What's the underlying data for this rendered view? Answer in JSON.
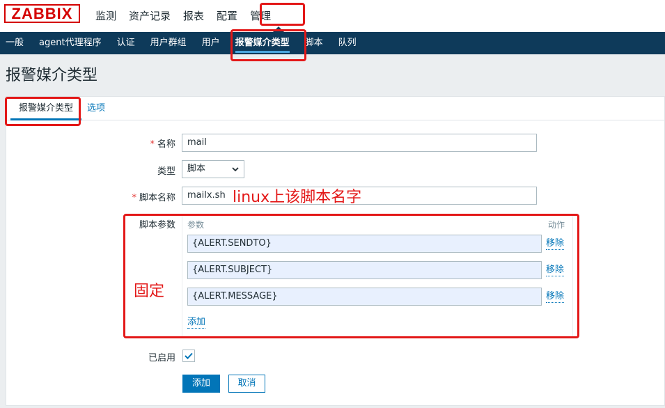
{
  "brand": {
    "logo": "ZABBIX"
  },
  "top_menu": [
    {
      "label": "监测"
    },
    {
      "label": "资产记录"
    },
    {
      "label": "报表"
    },
    {
      "label": "配置"
    },
    {
      "label": "管理"
    }
  ],
  "sub_menu": [
    {
      "label": "一般"
    },
    {
      "label": "agent代理程序"
    },
    {
      "label": "认证"
    },
    {
      "label": "用户群组"
    },
    {
      "label": "用户"
    },
    {
      "label": "报警媒介类型"
    },
    {
      "label": "脚本"
    },
    {
      "label": "队列"
    }
  ],
  "page": {
    "title": "报警媒介类型"
  },
  "tabs": [
    {
      "label": "报警媒介类型"
    },
    {
      "label": "选项"
    }
  ],
  "form": {
    "required_mark": "*",
    "name_label": "名称",
    "name_value": "mail",
    "type_label": "类型",
    "type_value": "脚本",
    "script_label": "脚本名称",
    "script_value": "mailx.sh",
    "params_label": "脚本参数",
    "params_header_param": "参数",
    "params_header_action": "动作",
    "params": [
      {
        "value": "{ALERT.SENDTO}",
        "remove": "移除"
      },
      {
        "value": "{ALERT.SUBJECT}",
        "remove": "移除"
      },
      {
        "value": "{ALERT.MESSAGE}",
        "remove": "移除"
      }
    ],
    "add_link": "添加",
    "enabled_label": "已启用",
    "enabled": true,
    "add_button": "添加",
    "cancel_button": "取消"
  },
  "annotations": {
    "script_note": "linux上该脚本名字",
    "fixed_note": "固定",
    "color": "#e31818"
  },
  "colors": {
    "nav_bg": "#0e3a5a",
    "link": "#0275b8",
    "accent": "#4aa5dd"
  }
}
